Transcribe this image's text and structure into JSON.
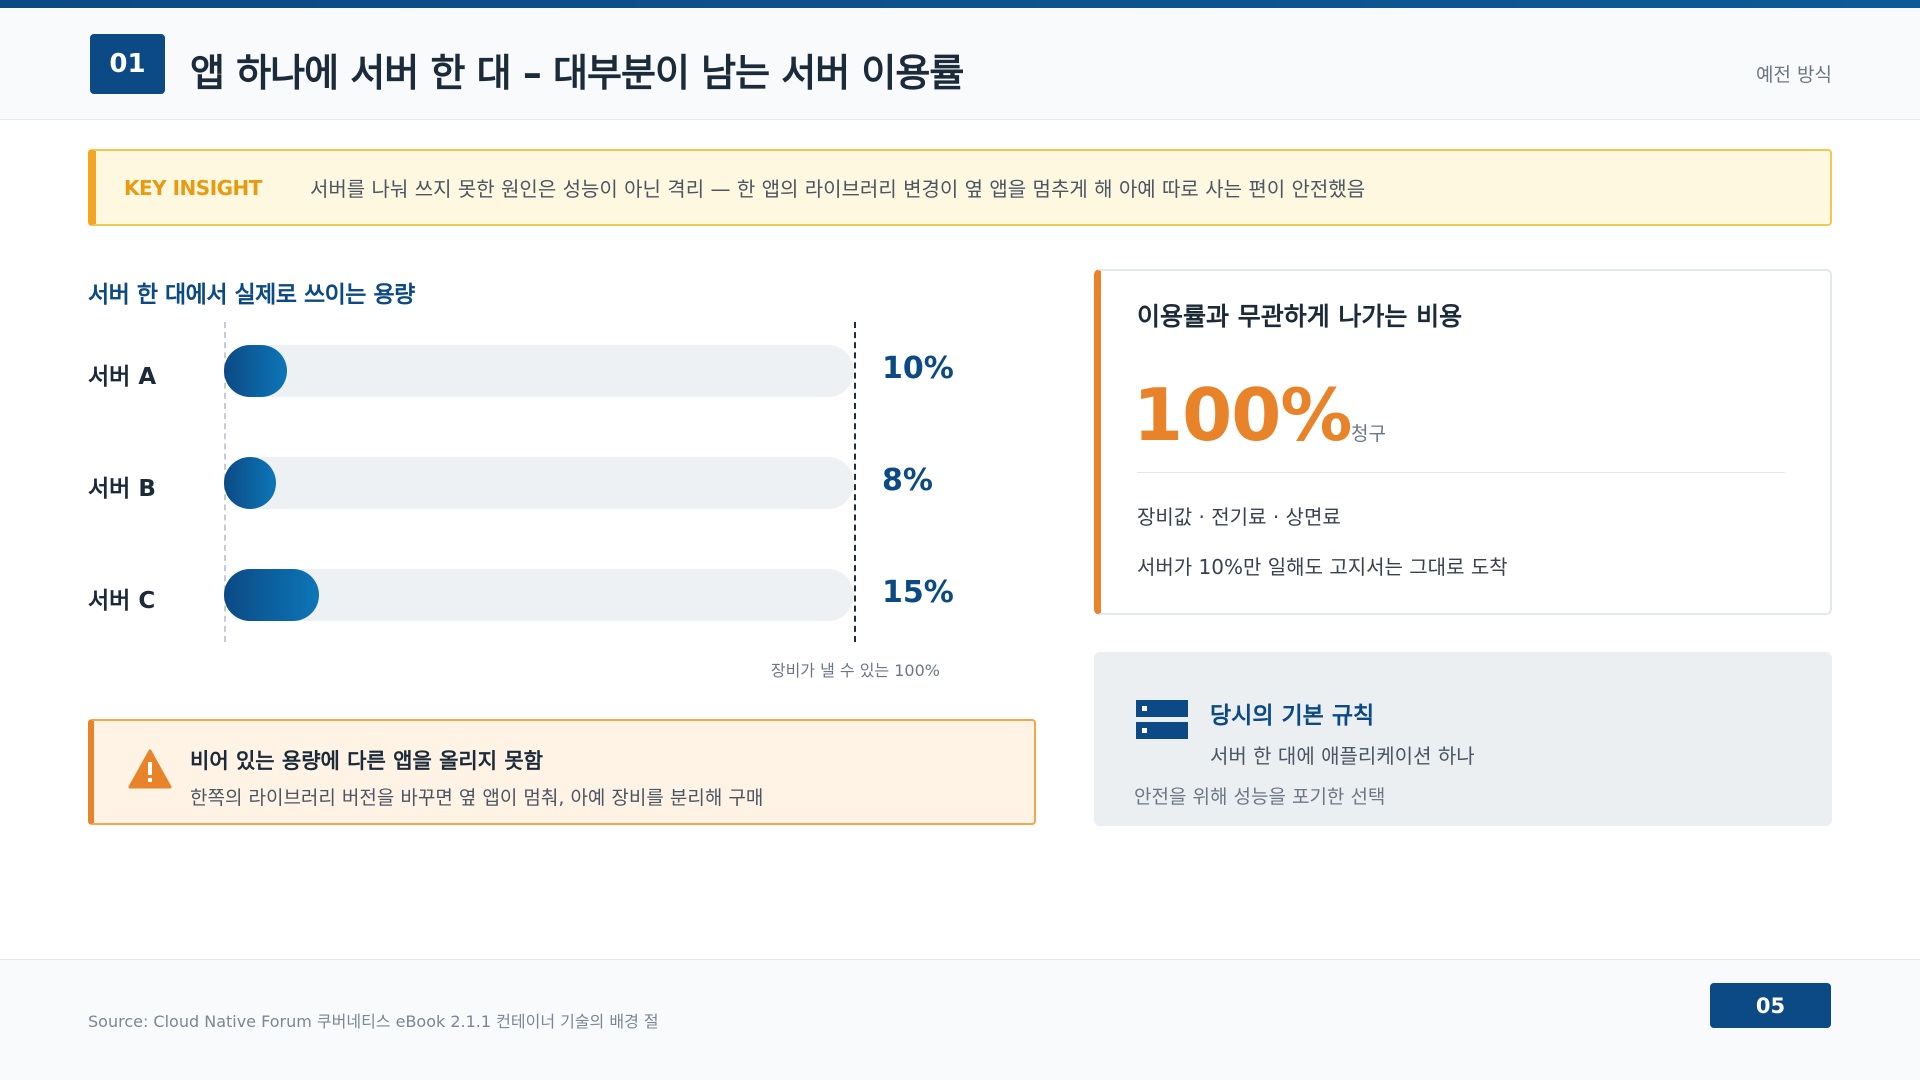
{
  "header": {
    "number": "01",
    "title": "앱 하나에 서버 한 대 – 대부분이 남는 서버 이용률",
    "corner_label": "예전 방식"
  },
  "insight": {
    "label": "KEY INSIGHT",
    "text": "서버를 나눠 쓰지 못한 원인은 성능이 아닌 격리 — 한 앱의 라이브러리 변경이 옆 앱을 멈추게 해 아예 따로 사는 편이 안전했음"
  },
  "chart_data": {
    "type": "bar",
    "orientation": "horizontal",
    "title": "서버 한 대에서 실제로 쓰이는 용량",
    "categories": [
      "서버 A",
      "서버 B",
      "서버 C"
    ],
    "values": [
      10,
      8,
      15
    ],
    "value_labels": [
      "10%",
      "8%",
      "15%"
    ],
    "xlim": [
      0,
      100
    ],
    "max_label": "장비가 낼 수 있는 100%",
    "colors": {
      "bar": "#0b4a84",
      "track": "#eef1f4"
    }
  },
  "warning": {
    "icon": "warning-triangle-icon",
    "title": "비어 있는 용량에 다른 앱을 올리지 못함",
    "text": "한쪽의 라이브러리 버전을 바꾸면 옆 앱이 멈춰, 아예 장비를 분리해 구매"
  },
  "cost": {
    "title": "이용률과 무관하게 나가는 비용",
    "big_value": "100%",
    "unit": "청구",
    "items": "장비값 · 전기료 · 상면료",
    "note": "서버가 10%만 일해도 고지서는 그대로 도착"
  },
  "rule": {
    "icon": "server-icon",
    "title": "당시의 기본 규칙",
    "subtitle": "서버 한 대에 애플리케이션 하나",
    "note": "안전을 위해 성능을 포기한 선택"
  },
  "footer": {
    "source": "Source: Cloud Native Forum 쿠버네티스 eBook 2.1.1 컨테이너 기술의 배경 절",
    "page": "05"
  },
  "colors": {
    "primary": "#0b4a84",
    "accent": "#e8832a",
    "insight": "#f2a623"
  }
}
